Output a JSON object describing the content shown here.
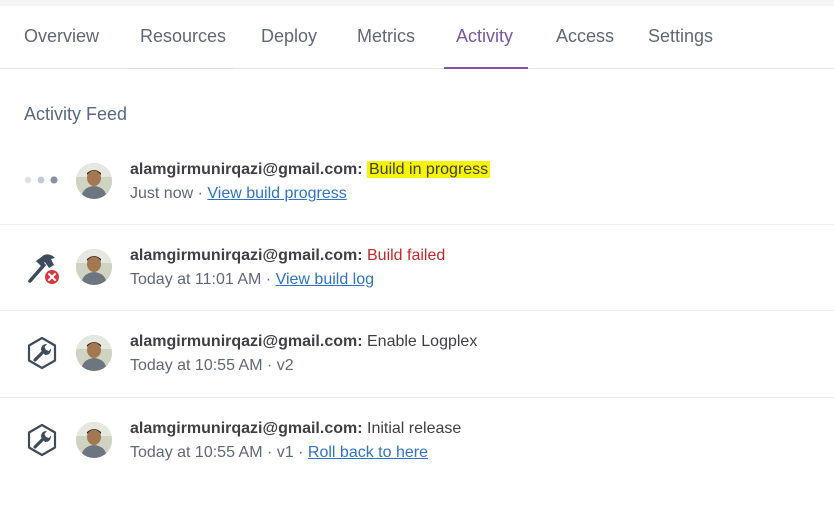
{
  "tabs": [
    {
      "label": "Overview"
    },
    {
      "label": "Resources"
    },
    {
      "label": "Deploy"
    },
    {
      "label": "Metrics"
    },
    {
      "label": "Activity"
    },
    {
      "label": "Access"
    },
    {
      "label": "Settings"
    }
  ],
  "active_tab": "Activity",
  "feed": {
    "title": "Activity Feed",
    "items": [
      {
        "icon": "progress-dots-icon",
        "email": "alamgirmunirqazi@gmail.com:",
        "status": "Build in progress",
        "time": "Just now",
        "separator": "·",
        "link": "View build progress",
        "extra": ""
      },
      {
        "icon": "hammer-error-icon",
        "email": "alamgirmunirqazi@gmail.com:",
        "status": "Build failed",
        "time": "Today at 11:01 AM",
        "separator": "·",
        "link": "View build log",
        "extra": ""
      },
      {
        "icon": "wrench-hexagon-icon",
        "email": "alamgirmunirqazi@gmail.com:",
        "status": "Enable Logplex",
        "time": "Today at 10:55 AM",
        "separator": "·",
        "link": "",
        "extra": "v2"
      },
      {
        "icon": "wrench-hexagon-icon",
        "email": "alamgirmunirqazi@gmail.com:",
        "status": "Initial release",
        "time": "Today at 10:55 AM",
        "separator": "·",
        "link": "Roll back to here",
        "extra": "v1"
      }
    ]
  },
  "colors": {
    "accent": "#79589f",
    "link": "#2e73c6",
    "failed": "#c4282d",
    "highlight": "#f6f400"
  }
}
